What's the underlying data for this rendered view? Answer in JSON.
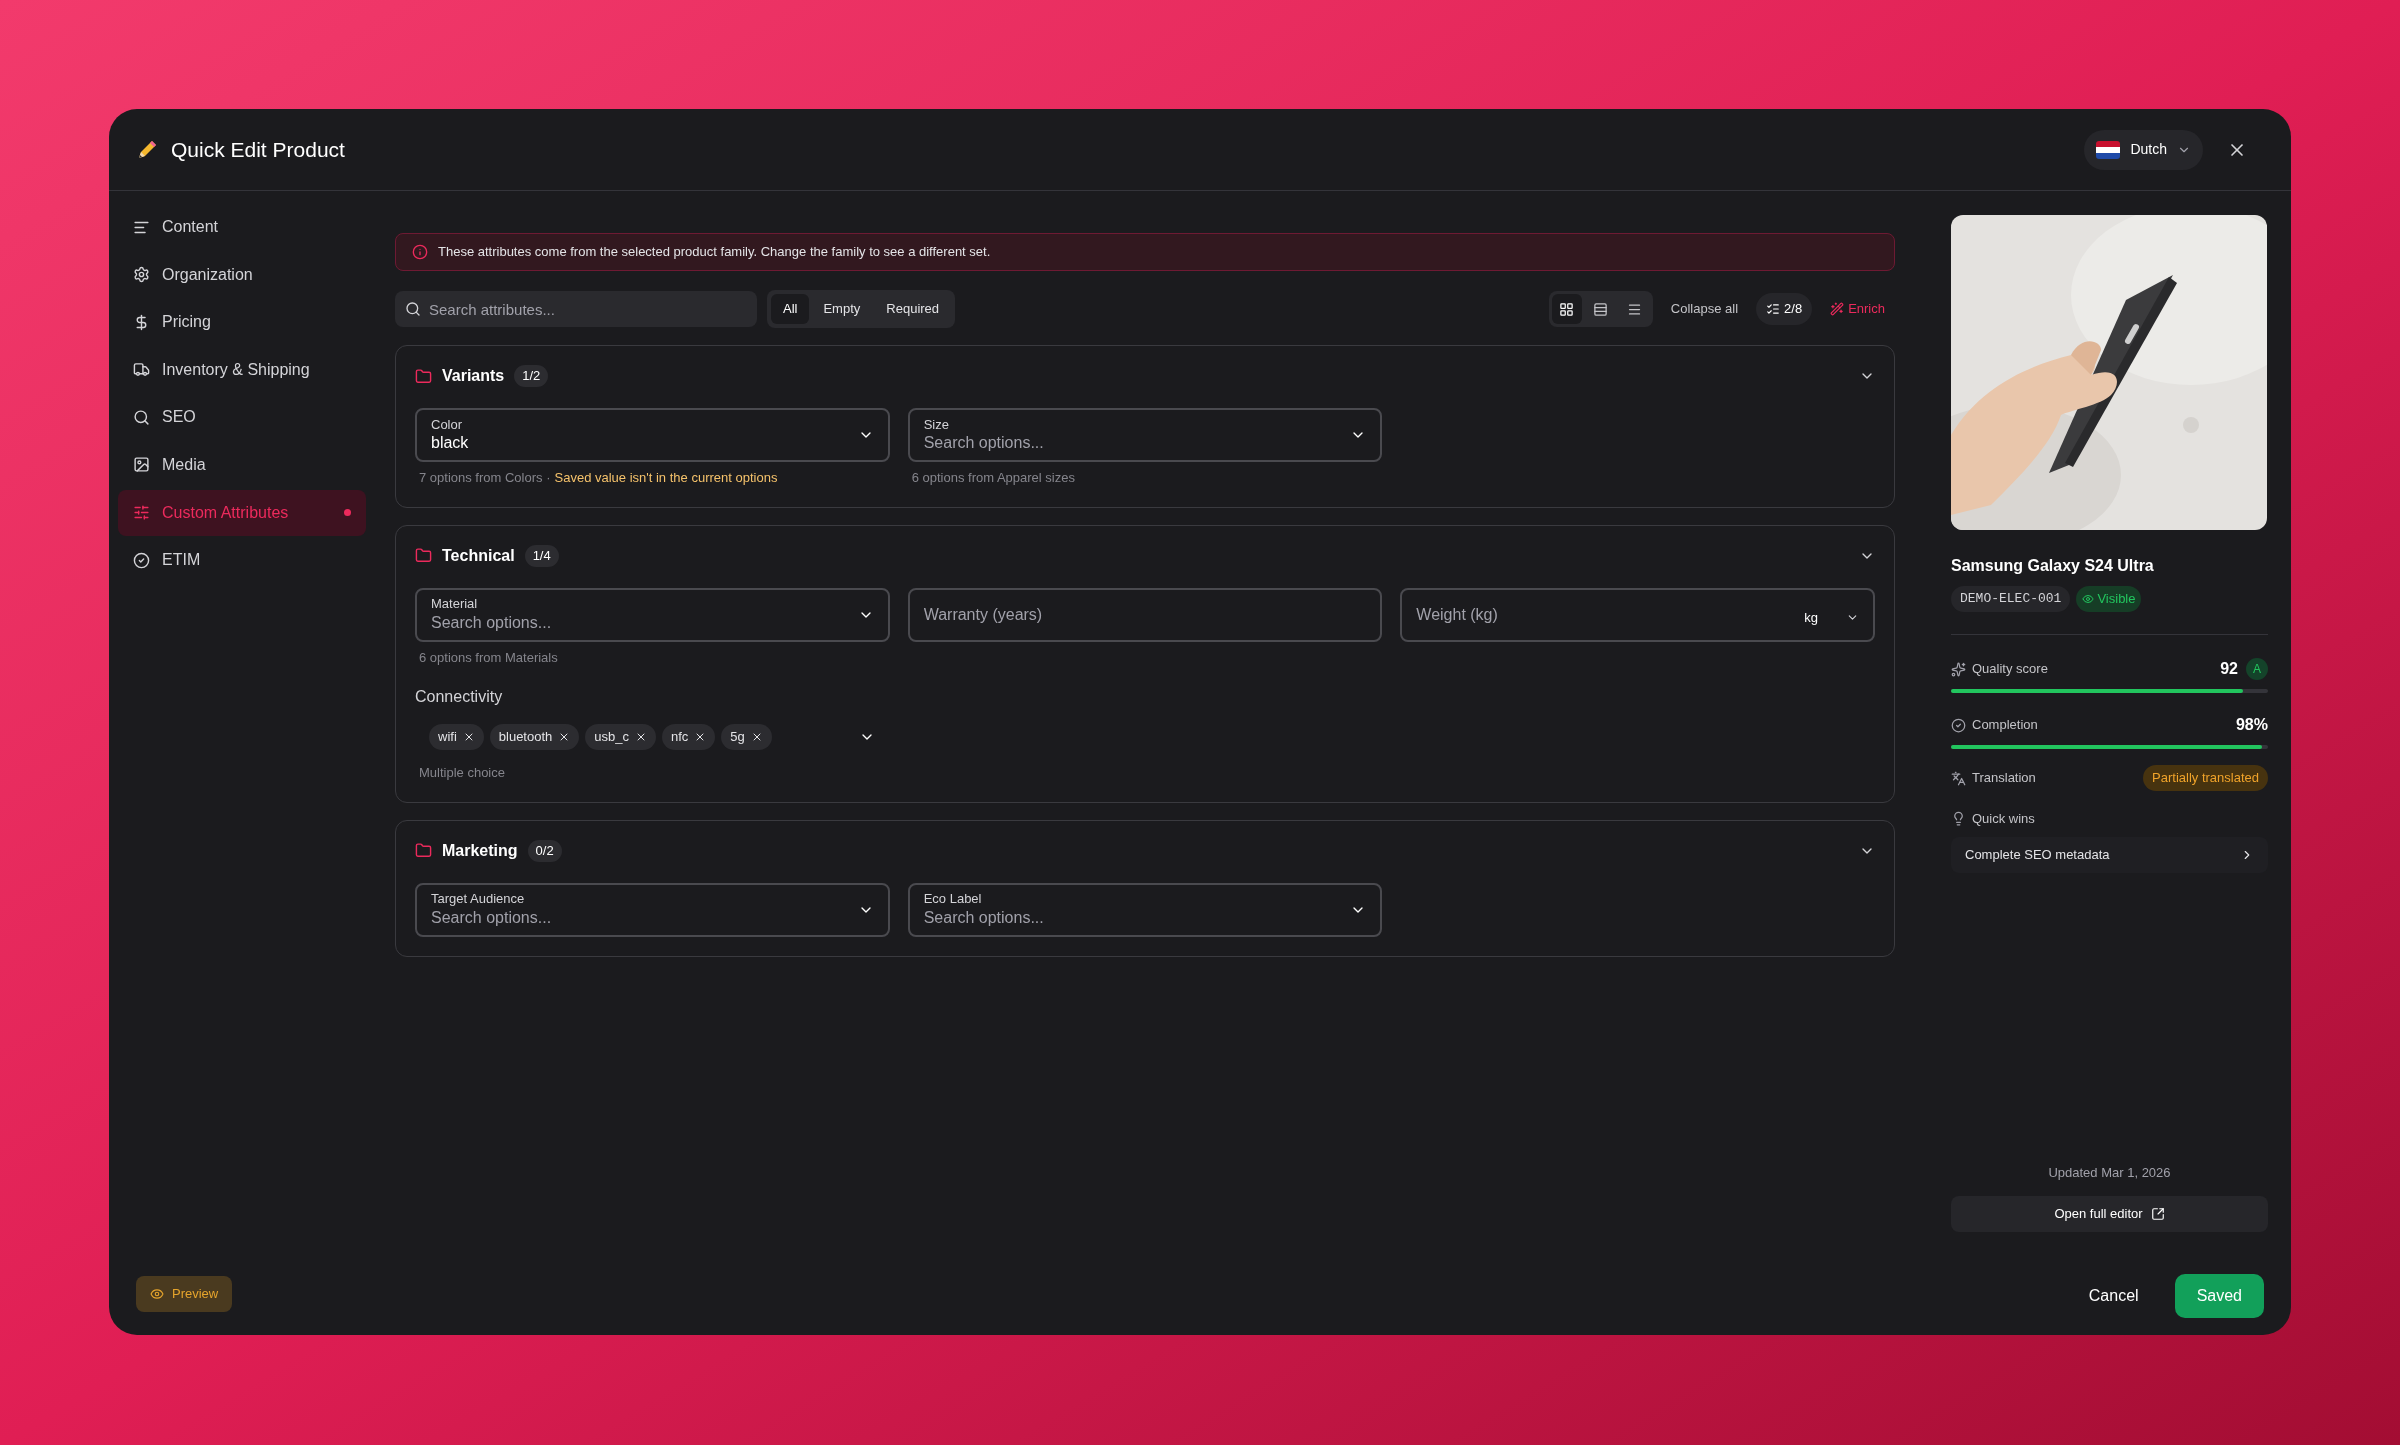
{
  "dialog": {
    "title": "Quick Edit Product",
    "language": "Dutch"
  },
  "sidebar": {
    "items": [
      {
        "label": "Content",
        "selected": false,
        "modified": false
      },
      {
        "label": "Organization",
        "selected": false,
        "modified": false
      },
      {
        "label": "Pricing",
        "selected": false,
        "modified": false
      },
      {
        "label": "Inventory & Shipping",
        "selected": false,
        "modified": false
      },
      {
        "label": "SEO",
        "selected": false,
        "modified": false
      },
      {
        "label": "Media",
        "selected": false,
        "modified": false
      },
      {
        "label": "Custom Attributes",
        "selected": true,
        "modified": true
      },
      {
        "label": "ETIM",
        "selected": false,
        "modified": false
      }
    ],
    "preview_button": "Preview"
  },
  "notice": "These attributes come from the selected product family. Change the family to see a different set.",
  "toolbar": {
    "search": {
      "placeholder": "Search attributes..."
    },
    "filters": [
      {
        "label": "All",
        "selected": true
      },
      {
        "label": "Empty",
        "selected": false
      },
      {
        "label": "Required",
        "selected": false
      }
    ],
    "views": [
      {
        "kind": "grid",
        "selected": true
      },
      {
        "kind": "rows",
        "selected": false
      },
      {
        "kind": "list",
        "selected": false
      }
    ],
    "collapse_all": "Collapse all",
    "progress": "2/8",
    "enrich": "Enrich"
  },
  "groups": [
    {
      "title": "Variants",
      "count": "1/2",
      "fields": [
        {
          "kind": "select",
          "label": "Color",
          "value": "black",
          "hint": "7 options from Colors ·",
          "warning": "Saved value isn't in the current options"
        },
        {
          "kind": "select",
          "label": "Size",
          "placeholder": "Search options...",
          "hint": "6 options from Apparel sizes"
        }
      ]
    },
    {
      "title": "Technical",
      "count": "1/4",
      "fields": [
        {
          "kind": "select",
          "label": "Material",
          "placeholder": "Search options...",
          "hint": "6 options from Materials"
        },
        {
          "kind": "text",
          "placeholder": "Warranty (years)"
        },
        {
          "kind": "unit",
          "placeholder": "Weight (kg)",
          "unit": "kg"
        },
        {
          "kind": "multiselect",
          "label": "Connectivity",
          "tags": [
            "wifi",
            "bluetooth",
            "usb_c",
            "nfc",
            "5g"
          ],
          "hint": "Multiple choice"
        }
      ]
    },
    {
      "title": "Marketing",
      "count": "0/2",
      "fields": [
        {
          "kind": "select",
          "label": "Target Audience",
          "placeholder": "Search options..."
        },
        {
          "kind": "select",
          "label": "Eco Label",
          "placeholder": "Search options..."
        }
      ]
    }
  ],
  "product": {
    "name": "Samsung Galaxy S24 Ultra",
    "sku": "DEMO-ELEC-001",
    "status": "Visible",
    "quality": {
      "label": "Quality score",
      "value": "92",
      "grade": "A",
      "level": 0.92
    },
    "completion": {
      "label": "Completion",
      "value": "98%",
      "level": 0.98
    },
    "translation": {
      "label": "Translation",
      "status": "Partially translated"
    },
    "quick_wins": {
      "label": "Quick wins",
      "items": [
        "Complete SEO metadata"
      ]
    },
    "updated": "Updated Mar 1, 2026",
    "open_editor": "Open full editor"
  },
  "footer": {
    "cancel": "Cancel",
    "save": "Saved"
  }
}
